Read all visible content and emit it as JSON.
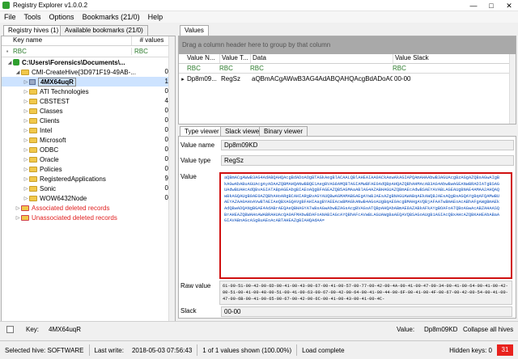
{
  "window": {
    "title": "Registry Explorer v1.0.0.2"
  },
  "menu": [
    "File",
    "Tools",
    "Options",
    "Bookmarks (21/0)",
    "Help"
  ],
  "left_tabs": [
    "Registry hives (1)",
    "Available bookmarks (21/0)"
  ],
  "tree": {
    "columns": [
      "Key name",
      "# values"
    ],
    "filter_symbol": "RBC",
    "rows": [
      {
        "label": "C:\\Users\\Forensics\\Documents\\...",
        "count": "",
        "indent": 0,
        "type": "root"
      },
      {
        "label": "CMI-CreateHive{3D971F19-49AB-...",
        "count": "0",
        "indent": 1,
        "type": "folder"
      },
      {
        "label": "4MX64uqR",
        "count": "1",
        "indent": 2,
        "type": "selected"
      },
      {
        "label": "ATI Technologies",
        "count": "0",
        "indent": 2,
        "type": "folder"
      },
      {
        "label": "CBSTEST",
        "count": "4",
        "indent": 2,
        "type": "folder"
      },
      {
        "label": "Classes",
        "count": "0",
        "indent": 2,
        "type": "folder"
      },
      {
        "label": "Clients",
        "count": "0",
        "indent": 2,
        "type": "folder"
      },
      {
        "label": "Intel",
        "count": "0",
        "indent": 2,
        "type": "folder"
      },
      {
        "label": "Microsoft",
        "count": "0",
        "indent": 2,
        "type": "folder"
      },
      {
        "label": "ODBC",
        "count": "0",
        "indent": 2,
        "type": "folder"
      },
      {
        "label": "Oracle",
        "count": "0",
        "indent": 2,
        "type": "folder"
      },
      {
        "label": "Policies",
        "count": "0",
        "indent": 2,
        "type": "folder"
      },
      {
        "label": "RegisteredApplications",
        "count": "9",
        "indent": 2,
        "type": "folder"
      },
      {
        "label": "Sonic",
        "count": "0",
        "indent": 2,
        "type": "folder"
      },
      {
        "label": "WOW6432Node",
        "count": "0",
        "indent": 2,
        "type": "folder"
      },
      {
        "label": "Associated deleted records",
        "count": "",
        "indent": 1,
        "type": "deleted"
      },
      {
        "label": "Unassociated deleted records",
        "count": "",
        "indent": 1,
        "type": "deleted"
      }
    ]
  },
  "values_tab": "Values",
  "values_grid": {
    "group_hint": "Drag a column header here to group by that column",
    "columns": [
      "Value N...",
      "Value T...",
      "Data",
      "Value Slack"
    ],
    "filter": [
      "RBC",
      "RBC",
      "RBC",
      "RBC"
    ],
    "row": {
      "name": "Dp8m09...",
      "type": "RegSz",
      "data": "aQBmACgAWwB3AG4AdABQAHQAcgBdADoAO...",
      "slack": "00-00"
    }
  },
  "viewer_tabs": [
    "Type viewer",
    "Slack viewer",
    "Binary viewer"
  ],
  "detail": {
    "value_name_label": "Value name",
    "value_name": "Dp8m09KD",
    "value_type_label": "Value type",
    "value_type": "RegSz",
    "value_label": "Value",
    "value_text": "aQBmACgAWwB3AG4AdABQAHQAcgBdADoAOgBTAGkAegBlACAALQBlAHEAIAA0ACkAewAkAGIAPQAmAHAAbwB3AGUAcgBzAGgAZQBsAGwAIgBkAGwAbABuAGUAcgAyADAAZQBMAHQANwBBQE1AegBVAG8AMQBTAGIAMwBFAE0AdQBpAHQAZQBhAHMAcAB3AG4AbwBwAGEANwBRADIATgBSAGUAdwBUAHcAdQBvAGIATABpAGEAbgBIAEoAQgBFAGEAZQB5AGMAaABlAG4AZABHAGUAZQBmAEcAdwBSAEYAVABLAGEAUgBNAE4AMAA2AHQAQwBkAGQAUgB0AE0AZQBhAHoARgBCAHIARgBvAGYAUQBwAGMAMABGAEgAYwBJAEsAZgBNAGUAWABqAEkAWQBJAEsAQgBsAGQAYgBqAFQAMwBUAEYAZAA0AHoAVwBTAEIAeQBXAGQAVgBFAHIAagBYAEEAcwBMAGkANwB4AGoAUgBqAE0AcgBMAHgAVQBjAFAATwBmAEoAcABhAFgAWgBmAEkAdQBwADQANgBGAE4AdABrAEQAeQBHAGYATwBsAGwAbwBZAGsAcgBVAGsATQBpAHQAbABmAE8AZABkAFkAYgBOAFoATQBoAGwAcABZAHAASQBrAHEAZQBWAHoAWABRAHUAcQA0AFMAbwBDAFoANABIAGcAYQBhAFcAVwBLAGUAWgBaAEQAVQBSAGoAUgB1AGIAcQBxAHcAZQBKAHEAbABaAGIAVABnAGcASgBuAEoAcABTAHEAZgBIAHQAdAA=",
    "raw_label": "Raw value",
    "raw_text": "61-00-51-00-42-00-6D-00-41-00-43-00-67-00-41-00-57-00-77-00-42-00-4A-00-41-00-47-00-34-00-41-00-64-00-41-00-42-00-51-00-41-00-48-00-51-00-41-00-63-00-67-00-42-00-64-00-41-00-44-00-6F-00-41-00-4F-00-67-00-42-00-54-00-41-00-47-00-6B-00-41-00-65-00-67-00-42-00-6C-00-41-00-43-00-41-00-4C-",
    "slack_label": "Slack",
    "slack": "00-00"
  },
  "bottom": {
    "key_label": "Key:",
    "key_value": "4MX64uqR",
    "value_label": "Value:",
    "value_value": "Dp8m09KD",
    "collapse_label": "Collapse all hives"
  },
  "status": {
    "selected_hive": "Selected hive: SOFTWARE",
    "last_write_label": "Last write:",
    "last_write": "2018-05-03 07:56:43",
    "shown": "1 of 1 values shown (100.00%)",
    "load": "Load complete",
    "hidden_keys": "Hidden keys: 0",
    "hidden_box": "31"
  }
}
